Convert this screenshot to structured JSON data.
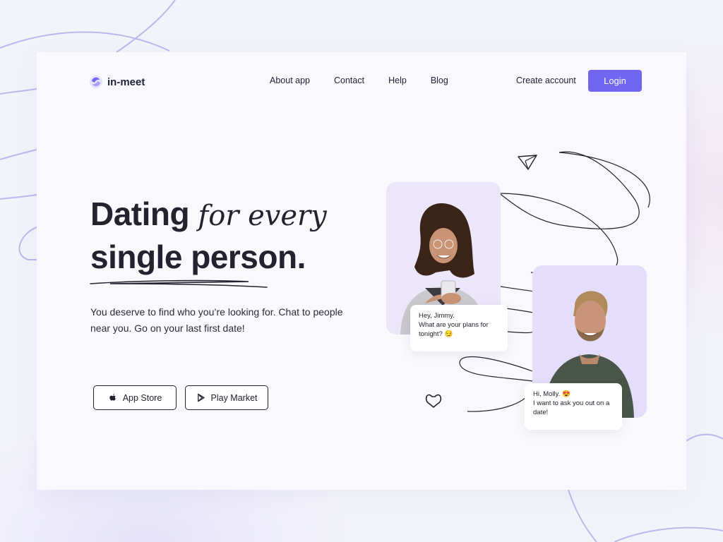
{
  "brand": {
    "name": "in-meet",
    "accent": "#7265f0",
    "icon": "logo-icon"
  },
  "nav": {
    "items": [
      "About app",
      "Contact",
      "Help",
      "Blog"
    ]
  },
  "header": {
    "create_account": "Create account",
    "login": "Login"
  },
  "hero": {
    "title_part1": "Dating ",
    "title_serif": "for every",
    "title_part2": "single person.",
    "subtitle": "You deserve to find who you’re looking for. Chat to people near you.  Go on your last first date!"
  },
  "stores": {
    "apple": "App Store",
    "play": "Play Market"
  },
  "chat": {
    "bubble1": "Hey, Jimmy.\nWhat are your plans for tonight? 😏",
    "bubble2": "Hi, Molly. 😍\nI want to ask you out on a date!"
  },
  "icons": {
    "paper_plane": "paper-plane-icon",
    "heart": "heart-icon",
    "apple": "apple-icon",
    "play": "play-icon"
  }
}
